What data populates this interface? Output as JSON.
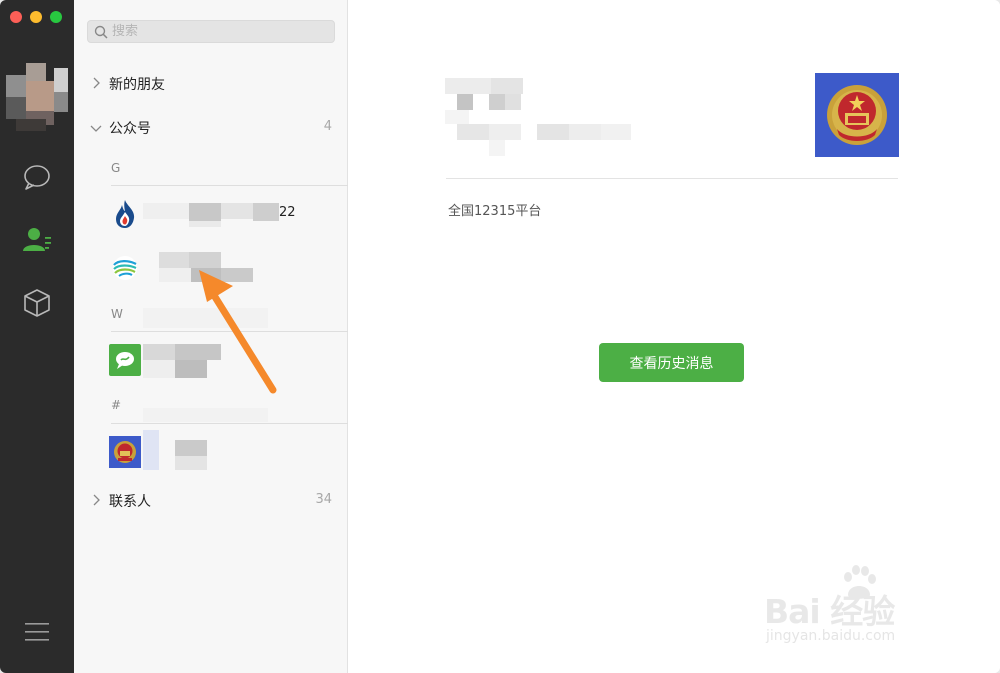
{
  "search": {
    "placeholder": "搜索"
  },
  "groups": {
    "new_friends": {
      "label": "新的朋友"
    },
    "official_accounts": {
      "label": "公众号",
      "count": "4"
    },
    "contacts": {
      "label": "联系人",
      "count": "34"
    }
  },
  "sections": [
    "G",
    "W",
    "#"
  ],
  "contacts_list": [
    {
      "icon": "flame-logo-icon",
      "suffix": "22"
    },
    {
      "icon": "china-mobile-logo-icon"
    },
    {
      "icon": "wechat-team-logo-icon"
    },
    {
      "icon": "national-emblem-icon"
    }
  ],
  "detail": {
    "description": "全国12315平台",
    "history_button": "查看历史消息"
  },
  "watermark": {
    "line1": "Bai  经验",
    "line2": "jingyan.baidu.com"
  },
  "colors": {
    "rail": "#2b2b2b",
    "accent": "#4caf45",
    "emblem_bg": "#3d5ac9",
    "arrow": "#f5892b"
  }
}
